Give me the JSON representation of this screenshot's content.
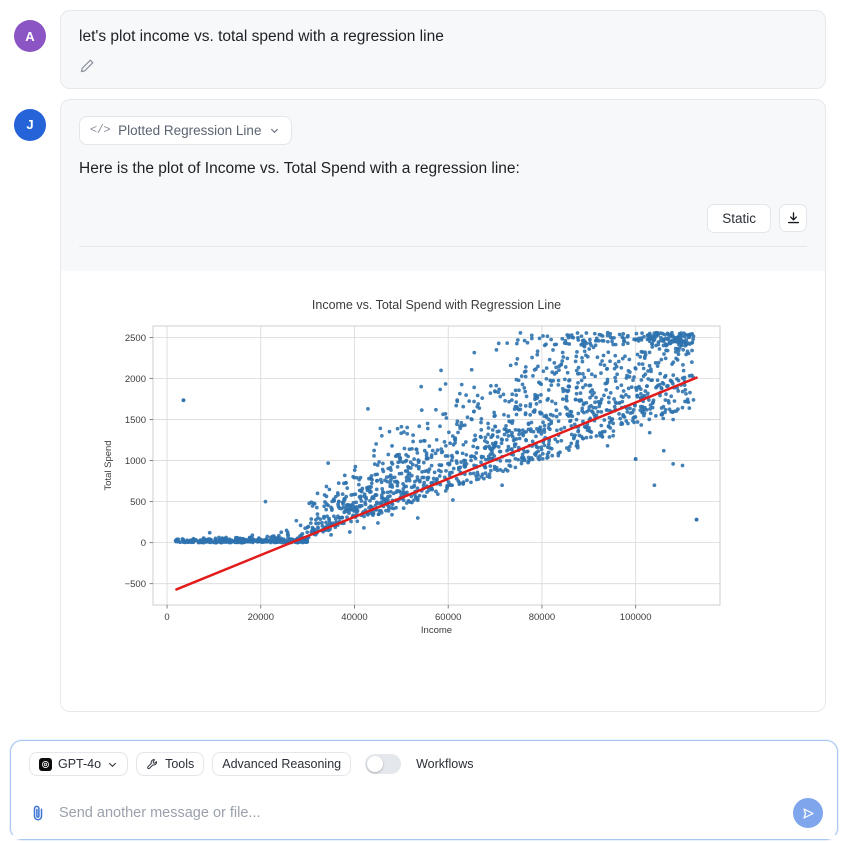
{
  "conversation": {
    "messages": [
      {
        "avatar_initial": "A",
        "avatar_color": "#8b56c4",
        "role": "user",
        "text": "let's plot income vs. total spend with a regression line",
        "edit_icon": "pencil-icon"
      },
      {
        "avatar_initial": "J",
        "avatar_color": "#2563d9",
        "role": "assistant",
        "code_chip_label": "Plotted Regression Line",
        "code_chip_icon": "code-icon",
        "code_chip_chevron": "chevron-down-icon",
        "text": "Here is the plot of Income vs. Total Spend with a regression line:"
      }
    ]
  },
  "artifact_toolbar": {
    "static_label": "Static",
    "download_icon": "download-icon"
  },
  "composer": {
    "model_label": "GPT-4o",
    "model_icon": "openai-icon",
    "model_chevron": "chevron-down-icon",
    "tools_label": "Tools",
    "tools_icon": "wrench-icon",
    "advanced_reasoning_label": "Advanced Reasoning",
    "workflows_label": "Workflows",
    "workflows_enabled": false,
    "attach_icon": "paperclip-icon",
    "input_value": "",
    "input_placeholder": "Send another message or file...",
    "send_icon": "send-icon",
    "send_color": "#7fa6ec"
  },
  "chart_data": {
    "type": "scatter",
    "title": "Income vs. Total Spend with Regression Line",
    "xlabel": "Income",
    "ylabel": "Total Spend",
    "xlim": [
      -3000,
      118000
    ],
    "ylim": [
      -760,
      2640
    ],
    "xticks": [
      0,
      20000,
      40000,
      60000,
      80000,
      100000
    ],
    "xtick_labels": [
      "0",
      "20000",
      "40000",
      "60000",
      "80000",
      "100000"
    ],
    "yticks": [
      -500,
      0,
      500,
      1000,
      1500,
      2000,
      2500
    ],
    "ytick_labels": [
      "−500",
      "0",
      "500",
      "1000",
      "1500",
      "2000",
      "2500"
    ],
    "grid": true,
    "legend": null,
    "series": [
      {
        "name": "Observations",
        "type": "scatter",
        "color": "#2e72ae",
        "marker_size": 3,
        "n_points": 1800,
        "description": "Dense band of points near Total Spend = 0 at low Income, fanning upward with increasing Income; heteroscedastic positive relationship.",
        "sample_points": [
          [
            3500,
            1735
          ],
          [
            1900,
            20
          ],
          [
            4100,
            15
          ],
          [
            6200,
            30
          ],
          [
            7800,
            55
          ],
          [
            9100,
            120
          ],
          [
            10400,
            25
          ],
          [
            12000,
            45
          ],
          [
            13500,
            10
          ],
          [
            15000,
            60
          ],
          [
            16800,
            35
          ],
          [
            18200,
            90
          ],
          [
            19500,
            20
          ],
          [
            21000,
            500
          ],
          [
            22500,
            75
          ],
          [
            24000,
            40
          ],
          [
            25500,
            150
          ],
          [
            27000,
            30
          ],
          [
            28500,
            210
          ],
          [
            30000,
            65
          ],
          [
            31200,
            480
          ],
          [
            32000,
            120
          ],
          [
            33500,
            300
          ],
          [
            35000,
            95
          ],
          [
            36000,
            560
          ],
          [
            37500,
            250
          ],
          [
            39000,
            130
          ],
          [
            40500,
            400
          ],
          [
            42000,
            180
          ],
          [
            43500,
            620
          ],
          [
            45000,
            240
          ],
          [
            46500,
            760
          ],
          [
            48000,
            340
          ],
          [
            49000,
            1060
          ],
          [
            50500,
            420
          ],
          [
            52000,
            980
          ],
          [
            53500,
            300
          ],
          [
            55000,
            1240
          ],
          [
            56500,
            660
          ],
          [
            58000,
            880
          ],
          [
            59500,
            1180
          ],
          [
            61000,
            520
          ],
          [
            62500,
            1420
          ],
          [
            64000,
            760
          ],
          [
            65500,
            1600
          ],
          [
            67000,
            980
          ],
          [
            68500,
            1320
          ],
          [
            70000,
            1840
          ],
          [
            71500,
            700
          ],
          [
            73000,
            1480
          ],
          [
            74500,
            2180
          ],
          [
            76000,
            1140
          ],
          [
            77500,
            1660
          ],
          [
            79000,
            2290
          ],
          [
            80500,
            1380
          ],
          [
            82000,
            1920
          ],
          [
            83500,
            1060
          ],
          [
            85000,
            2460
          ],
          [
            86500,
            1540
          ],
          [
            88000,
            2060
          ],
          [
            89500,
            1280
          ],
          [
            91000,
            2380
          ],
          [
            92500,
            1720
          ],
          [
            94000,
            1180
          ],
          [
            95500,
            2120
          ],
          [
            97000,
            1460
          ],
          [
            98500,
            1880
          ],
          [
            100000,
            1020
          ],
          [
            101500,
            1640
          ],
          [
            103000,
            1340
          ],
          [
            104500,
            1900
          ],
          [
            106000,
            1120
          ],
          [
            108000,
            1500
          ],
          [
            110000,
            940
          ],
          [
            113000,
            280
          ]
        ]
      },
      {
        "name": "Regression Line",
        "type": "line",
        "color": "#e21b1b",
        "line_width": 2.5,
        "endpoints": [
          [
            2000,
            -570
          ],
          [
            113000,
            2010
          ]
        ],
        "slope": 0.02324,
        "intercept": -616
      }
    ]
  }
}
